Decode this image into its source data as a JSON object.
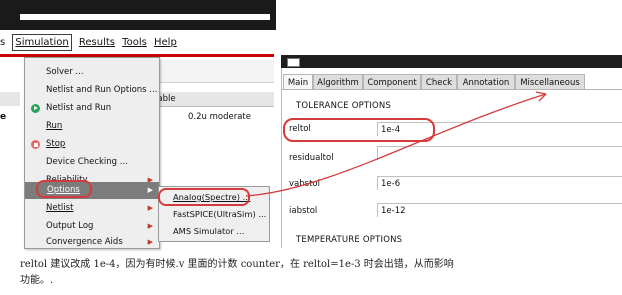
{
  "menubar": {
    "items": [
      "s",
      "Simulation",
      "Results",
      "Tools",
      "Help"
    ]
  },
  "background_table": {
    "col_header": "nable",
    "row_left": "e",
    "row_value": "0.2u moderate"
  },
  "simulation_menu": {
    "items": [
      {
        "label": "Solver ...",
        "icon": ""
      },
      {
        "label": "Netlist and Run Options ...",
        "icon": ""
      },
      {
        "label": "Netlist and Run",
        "icon": "play-icon"
      },
      {
        "label": "Run",
        "icon": ""
      },
      {
        "label": "Stop",
        "icon": "stop-icon"
      },
      {
        "label": "Device Checking ...",
        "icon": ""
      },
      {
        "label": "Reliability",
        "icon": "",
        "submenu": true
      },
      {
        "label": "Options",
        "icon": "",
        "submenu": true,
        "active": true
      },
      {
        "label": "Netlist",
        "icon": "",
        "submenu": true
      },
      {
        "label": "Output Log",
        "icon": "",
        "submenu": true
      },
      {
        "label": "Convergence Aids",
        "icon": "",
        "submenu": true
      }
    ]
  },
  "options_submenu": {
    "items": [
      "Analog(Spectre) ...",
      "FastSPICE(UltraSim) ...",
      "AMS Simulator ..."
    ]
  },
  "dialog": {
    "tabs": [
      "Main",
      "Algorithm",
      "Component",
      "Check",
      "Annotation",
      "Miscellaneous"
    ],
    "active_tab": "Main",
    "tolerance_title": "TOLERANCE OPTIONS",
    "fields": [
      {
        "label": "reltol",
        "value": "1e-4"
      },
      {
        "label": "residualtol",
        "value": ""
      },
      {
        "label": "vabstol",
        "value": "1e-6"
      },
      {
        "label": "iabstol",
        "value": "1e-12"
      }
    ],
    "temperature_title": "TEMPERATURE OPTIONS"
  },
  "caption": {
    "line1": "reltol 建议改成 1e-4，因为有时候.v 里面的计数 counter，在 reltol=1e-3 时会出错，从而影响",
    "line2": "功能。."
  },
  "colors": {
    "annotation_red": "#d63a3a",
    "menu_highlight": "#7c7c7c"
  }
}
